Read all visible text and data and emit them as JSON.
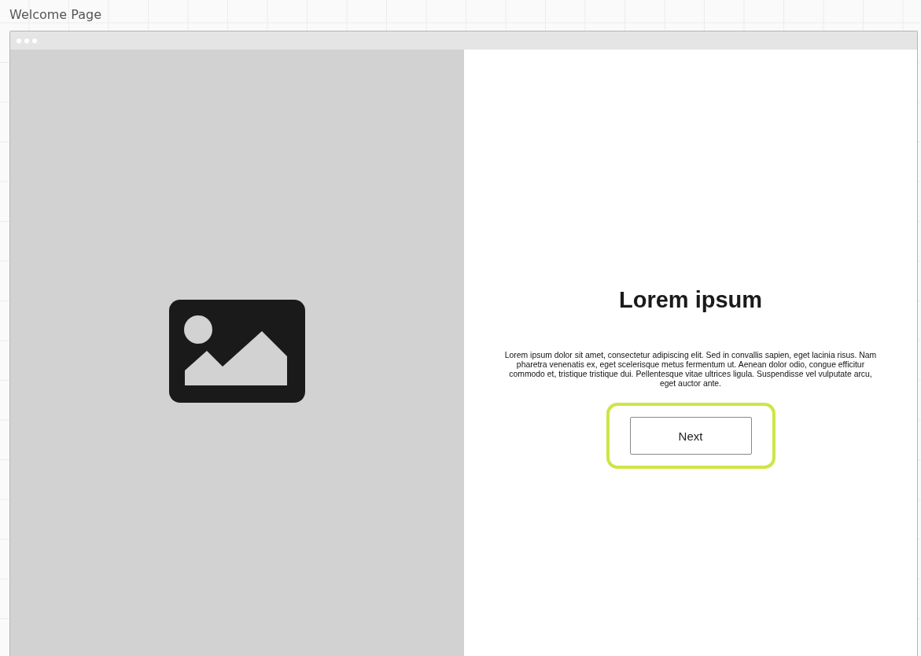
{
  "page_title": "Welcome Page",
  "hero": {
    "kind": "picture-placeholder"
  },
  "content": {
    "heading": "Lorem ipsum",
    "body": "Lorem ipsum dolor sit amet, consectetur adipiscing elit. Sed in convallis sapien, eget lacinia risus. Nam pharetra venenatis ex, eget  scelerisque metus fermentum ut. Aenean dolor odio, congue efficitur  commodo et, tristique tristique dui. Pellentesque vitae ultrices ligula. Suspendisse vel vulputate arcu, eget auctor ante.",
    "button": {
      "label": "Next",
      "highlighted": true
    }
  }
}
